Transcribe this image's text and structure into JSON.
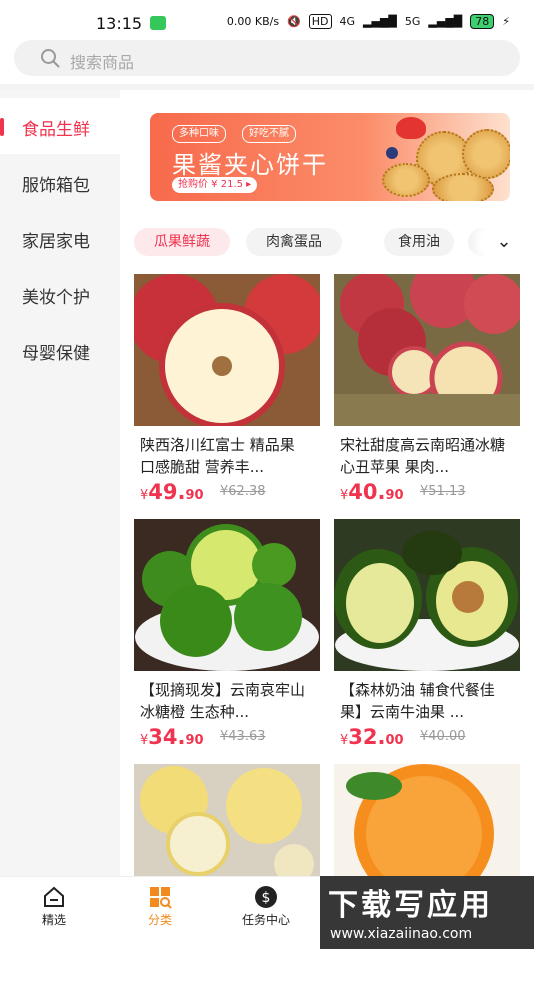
{
  "status_bar": {
    "time": "13:15",
    "net_speed": "0.00 KB/s",
    "hd": "HD",
    "sig1": "4G",
    "sig2": "5G",
    "battery": "78"
  },
  "search": {
    "placeholder": "搜索商品"
  },
  "sidebar": {
    "items": [
      {
        "label": "食品生鲜",
        "active": true
      },
      {
        "label": "服饰箱包"
      },
      {
        "label": "家居家电"
      },
      {
        "label": "美妆个护"
      },
      {
        "label": "母婴保健"
      }
    ]
  },
  "banner": {
    "tag1": "多种口味",
    "tag2": "好吃不腻",
    "headline": "果酱夹心饼干",
    "price_label": "抢购价 ¥ 21.5 ▸"
  },
  "chips": [
    {
      "label": "瓜果鲜蔬",
      "active": true
    },
    {
      "label": "肉禽蛋品"
    },
    {
      "label": "食用油"
    }
  ],
  "products": [
    {
      "title": "陕西洛川红富士 精品果 口感脆甜 营养丰...",
      "yen": "¥",
      "price_int": "49.",
      "price_dec": "90",
      "orig": "¥62.38"
    },
    {
      "title": "宋社甜度高云南昭通冰糖心丑苹果 果肉...",
      "yen": "¥",
      "price_int": "40.",
      "price_dec": "90",
      "orig": "¥51.13"
    },
    {
      "title": "【现摘现发】云南哀牢山冰糖橙 生态种...",
      "yen": "¥",
      "price_int": "34.",
      "price_dec": "90",
      "orig": "¥43.63"
    },
    {
      "title": "【森林奶油 辅食代餐佳果】云南牛油果 ...",
      "yen": "¥",
      "price_int": "32.",
      "price_dec": "00",
      "orig": "¥40.00"
    },
    {
      "title": "",
      "yen": "",
      "price_int": "",
      "price_dec": "",
      "orig": ""
    },
    {
      "title": "",
      "yen": "",
      "price_int": "",
      "price_dec": "",
      "orig": ""
    }
  ],
  "tabbar": [
    {
      "label": "精选"
    },
    {
      "label": "分类",
      "active": true,
      "color": "#f28b1f"
    },
    {
      "label": "任务中心"
    }
  ],
  "watermark": {
    "title": "下载写应用",
    "url": "www.xiazaiinao.com"
  },
  "colors": {
    "accent": "#f0334e",
    "tab_active": "#f28b1f",
    "banner": "#f86a4c"
  }
}
